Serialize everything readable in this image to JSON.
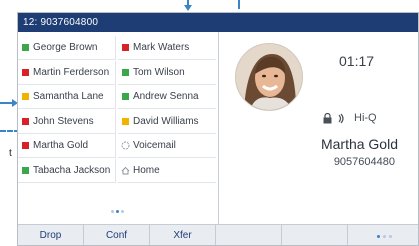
{
  "topbar": {
    "line_label": "12: 9037604800"
  },
  "lines_left": [
    {
      "label": "George Brown",
      "status": "green"
    },
    {
      "label": "Martin Ferderson",
      "status": "red"
    },
    {
      "label": "Samantha Lane",
      "status": "yellow"
    },
    {
      "label": "John Stevens",
      "status": "red"
    },
    {
      "label": "Martha Gold",
      "status": "red"
    },
    {
      "label": "Tabacha Jackson",
      "status": "green"
    }
  ],
  "lines_right": [
    {
      "label": "Mark Waters",
      "status": "red",
      "icon": "led-icon"
    },
    {
      "label": "Tom Wilson",
      "status": "green",
      "icon": "led-icon"
    },
    {
      "label": "Andrew Senna",
      "status": "green",
      "icon": "led-icon"
    },
    {
      "label": "David Williams",
      "status": "yellow",
      "icon": "led-icon"
    },
    {
      "label": "Voicemail",
      "status": "none",
      "icon": "voicemail-icon"
    },
    {
      "label": "Home",
      "status": "none",
      "icon": "home-icon"
    }
  ],
  "call": {
    "timer": "01:17",
    "hd_label": "Hi-Q",
    "caller_name": "Martha Gold",
    "caller_number": "9057604480"
  },
  "softkeys": [
    {
      "label": "Drop"
    },
    {
      "label": "Conf"
    },
    {
      "label": "Xfer"
    },
    {
      "label": ""
    },
    {
      "label": ""
    }
  ],
  "annotations": {
    "side_label": "t"
  },
  "colors": {
    "topbar": "#1e3d74",
    "accent": "#3c84c8",
    "green": "#3ca64a",
    "red": "#d8222a",
    "yellow": "#f0b400"
  }
}
